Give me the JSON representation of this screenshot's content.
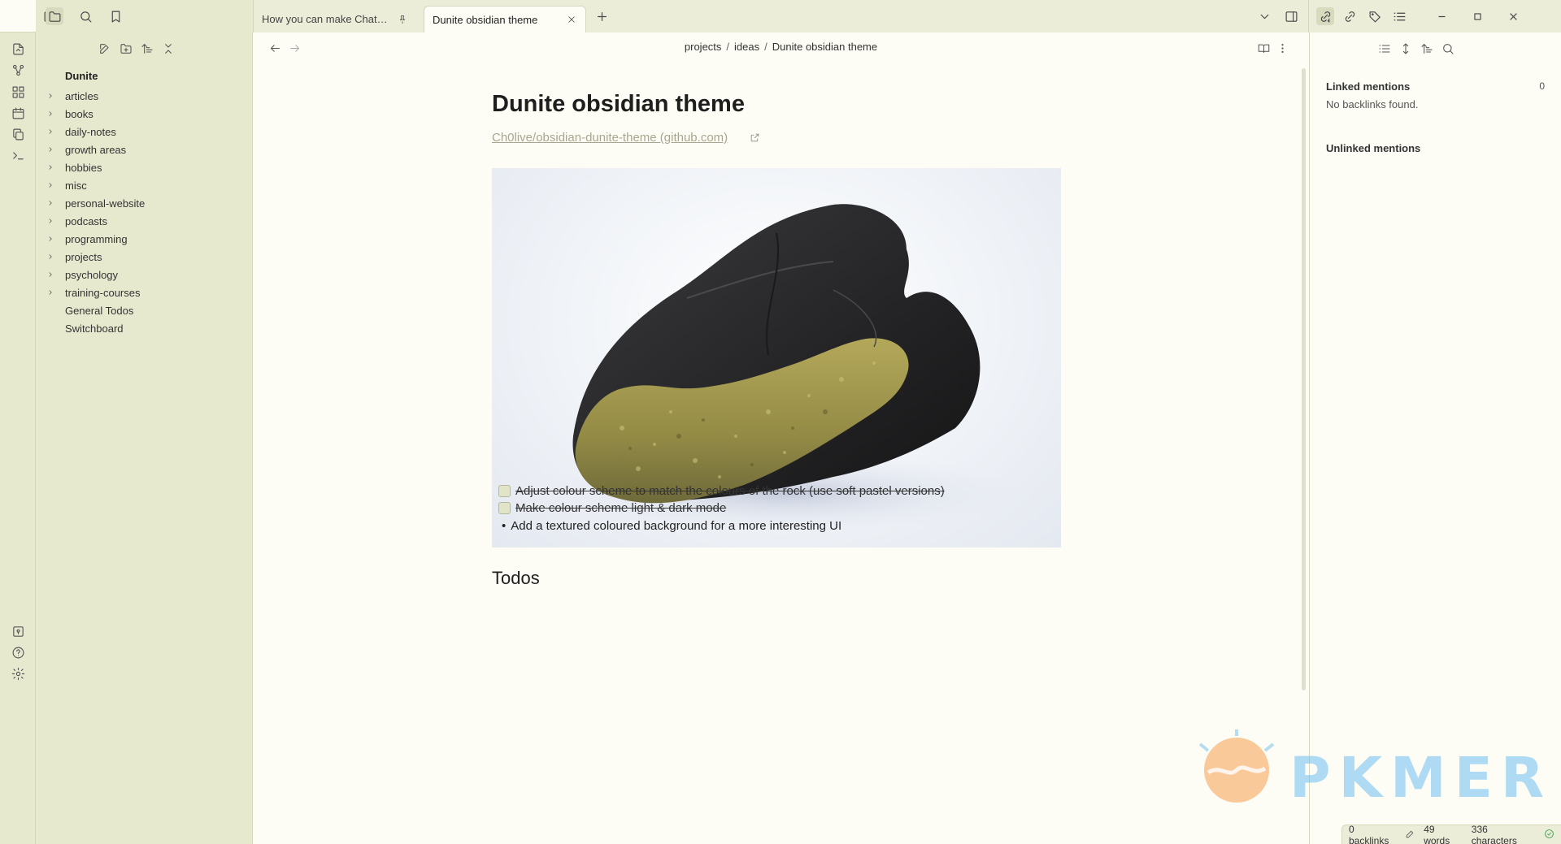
{
  "ribbon": {
    "icons": [
      "open-quick-switcher-icon",
      "graph-view-icon",
      "canvas-icon",
      "daily-note-icon",
      "templates-icon",
      "command-palette-icon"
    ],
    "bottom_icons": [
      "vault-switcher-icon",
      "help-icon",
      "settings-icon"
    ]
  },
  "topbar": {
    "left_icons": [
      "sidebar-toggle-icon",
      "files-icon",
      "search-icon",
      "bookmarks-icon"
    ],
    "tabs": [
      {
        "title": "How you can make ChatG...",
        "state": "inactive",
        "action": "pin-icon"
      },
      {
        "title": "Dunite obsidian theme",
        "state": "active",
        "action": "close-icon"
      }
    ],
    "new_tab_icon": "plus-icon",
    "right_icons": [
      "tab-list-chevron-icon",
      "right-sidebar-toggle-icon"
    ],
    "panel_icons": [
      "backlinks-icon",
      "outgoing-links-icon",
      "tags-icon",
      "outline-icon"
    ],
    "window_controls": [
      "minimize-icon",
      "maximize-icon",
      "close-window-icon"
    ]
  },
  "explorer": {
    "toolbar": [
      "new-note-icon",
      "new-folder-icon",
      "sort-icon",
      "collapse-all-icon"
    ],
    "vault_name": "Dunite",
    "folders": [
      "articles",
      "books",
      "daily-notes",
      "growth areas",
      "hobbies",
      "misc",
      "personal-website",
      "podcasts",
      "programming",
      "projects",
      "psychology",
      "training-courses"
    ],
    "files": [
      "General Todos",
      "Switchboard"
    ]
  },
  "editor": {
    "breadcrumb": [
      "projects",
      "ideas",
      "Dunite obsidian theme"
    ],
    "breadcrumb_sep": "/",
    "title": "Dunite obsidian theme",
    "link_text": "Ch0live/obsidian-dunite-theme (github.com)",
    "image_alt": "dunite rock sample",
    "todos_heading": "Todos",
    "todos": [
      {
        "text": " Adjust colour scheme to match the colours of the rock (use soft pastel versions)",
        "done": true
      },
      {
        "text": " Make colour scheme light & dark mode",
        "done": true
      }
    ],
    "bullets": [
      "Add a textured coloured background for a more interesting UI"
    ],
    "bullet_char": "•"
  },
  "rightbar": {
    "toolbar": [
      "list-icon",
      "expand-icon",
      "sort-icon",
      "search-icon"
    ],
    "linked_heading": "Linked mentions",
    "linked_count": "0",
    "linked_empty": "No backlinks found.",
    "unlinked_heading": "Unlinked mentions"
  },
  "watermark": {
    "text": "PKMER"
  },
  "status": {
    "backlinks": "0 backlinks",
    "words": "49 words",
    "chars": "336 characters"
  },
  "colors": {
    "sidebar_bg": "#e7e9cf",
    "editor_bg": "#fdfdf5",
    "link": "#a8a68f"
  }
}
